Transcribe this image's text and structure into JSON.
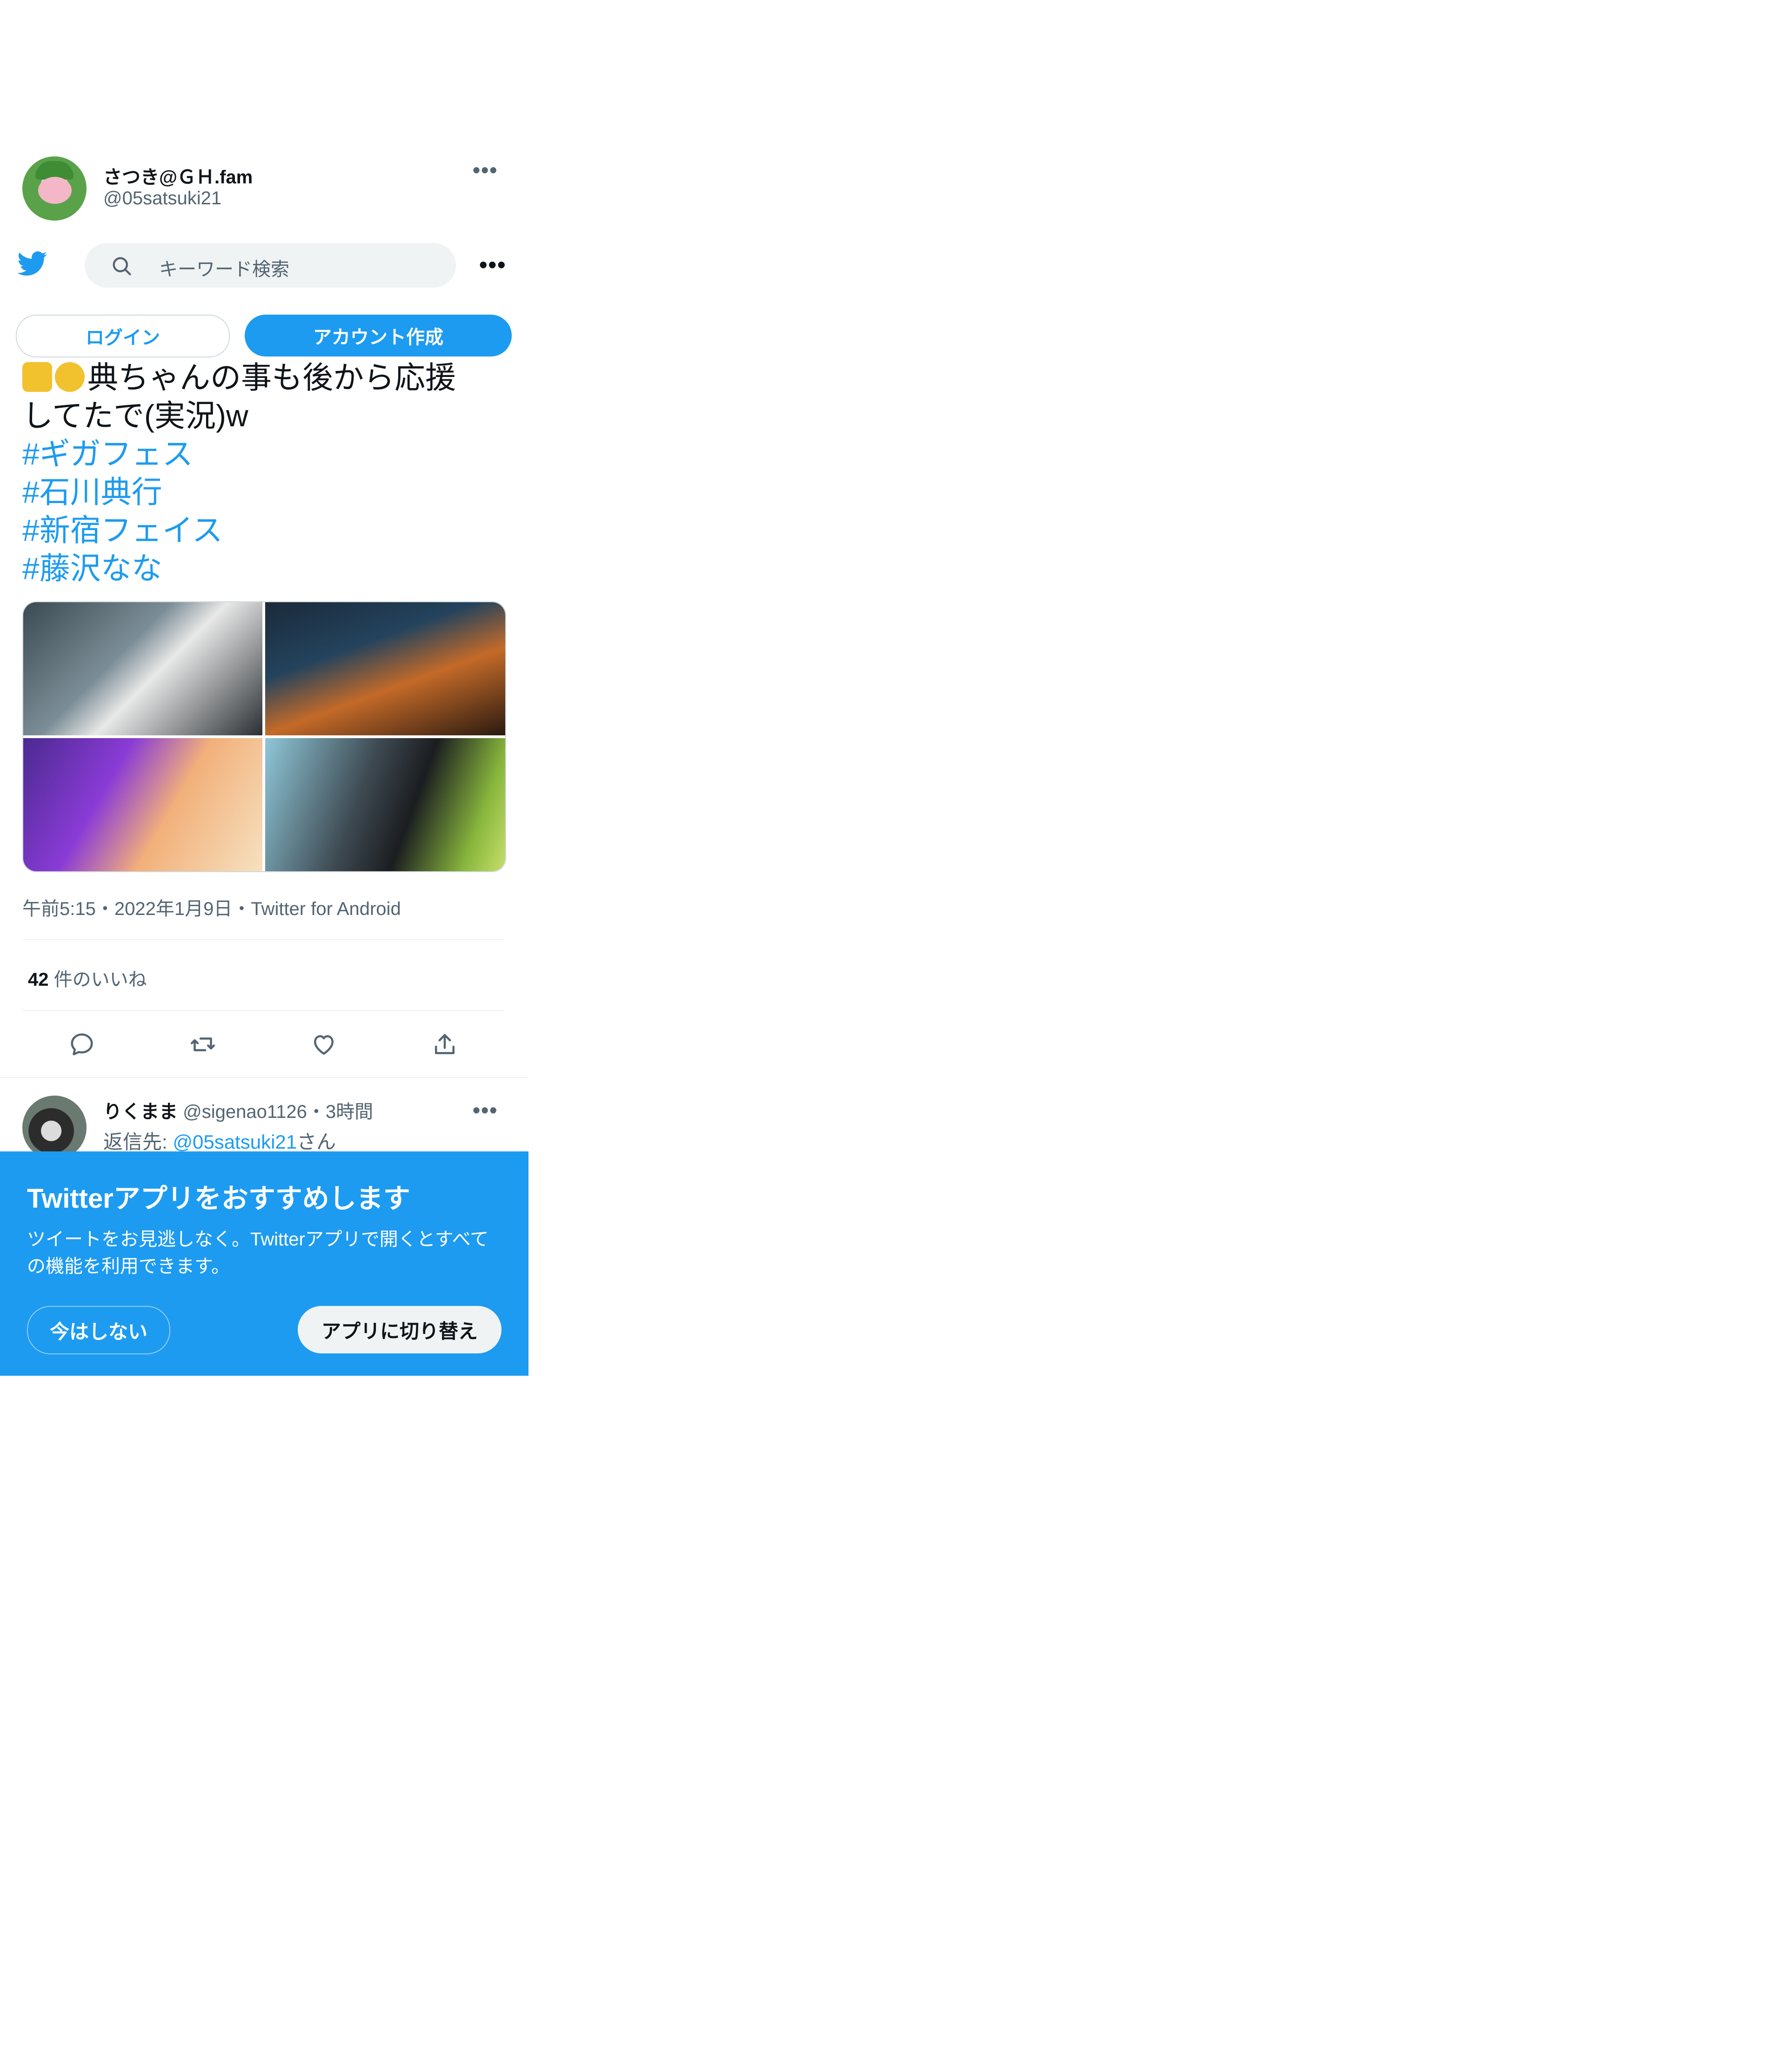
{
  "author": {
    "display_name": "さつき@ＧＨ.fam",
    "handle": "@05satsuki21"
  },
  "search": {
    "placeholder": "キーワード検索"
  },
  "auth": {
    "login_label": "ログイン",
    "signup_label": "アカウント作成"
  },
  "tweet": {
    "text_line1": "典ちゃんの事も後から応援",
    "text_line2": "してたで(実況)w",
    "hashtags": [
      "#ギガフェス",
      "#石川典行",
      "#新宿フェイス",
      "#藤沢なな"
    ],
    "meta": "午前5:15・2022年1月9日・Twitter for Android",
    "like_count": "42",
    "like_label": " 件のいいね"
  },
  "reply": {
    "display_name": "りくまま",
    "handle_time": " @sigenao1126・3時間",
    "reply_prefix": "返信先: ",
    "reply_mention": "@05satsuki21",
    "reply_suffix": "さん"
  },
  "app_banner": {
    "title": "Twitterアプリをおすすめします",
    "description": "ツイートをお見逃しなく。Twitterアプリで開くとすべての機能を利用できます。",
    "not_now_label": "今はしない",
    "switch_label": "アプリに切り替え"
  },
  "colors": {
    "brand": "#1d9bf0",
    "text": "#0f1419",
    "secondary": "#536471"
  }
}
